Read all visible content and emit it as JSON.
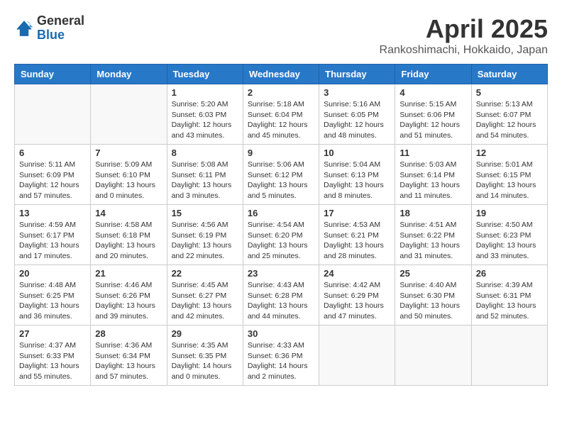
{
  "header": {
    "logo_general": "General",
    "logo_blue": "Blue",
    "title": "April 2025",
    "location": "Rankoshimachi, Hokkaido, Japan"
  },
  "days_of_week": [
    "Sunday",
    "Monday",
    "Tuesday",
    "Wednesday",
    "Thursday",
    "Friday",
    "Saturday"
  ],
  "weeks": [
    [
      {
        "day": "",
        "info": ""
      },
      {
        "day": "",
        "info": ""
      },
      {
        "day": "1",
        "info": "Sunrise: 5:20 AM\nSunset: 6:03 PM\nDaylight: 12 hours and 43 minutes."
      },
      {
        "day": "2",
        "info": "Sunrise: 5:18 AM\nSunset: 6:04 PM\nDaylight: 12 hours and 45 minutes."
      },
      {
        "day": "3",
        "info": "Sunrise: 5:16 AM\nSunset: 6:05 PM\nDaylight: 12 hours and 48 minutes."
      },
      {
        "day": "4",
        "info": "Sunrise: 5:15 AM\nSunset: 6:06 PM\nDaylight: 12 hours and 51 minutes."
      },
      {
        "day": "5",
        "info": "Sunrise: 5:13 AM\nSunset: 6:07 PM\nDaylight: 12 hours and 54 minutes."
      }
    ],
    [
      {
        "day": "6",
        "info": "Sunrise: 5:11 AM\nSunset: 6:09 PM\nDaylight: 12 hours and 57 minutes."
      },
      {
        "day": "7",
        "info": "Sunrise: 5:09 AM\nSunset: 6:10 PM\nDaylight: 13 hours and 0 minutes."
      },
      {
        "day": "8",
        "info": "Sunrise: 5:08 AM\nSunset: 6:11 PM\nDaylight: 13 hours and 3 minutes."
      },
      {
        "day": "9",
        "info": "Sunrise: 5:06 AM\nSunset: 6:12 PM\nDaylight: 13 hours and 5 minutes."
      },
      {
        "day": "10",
        "info": "Sunrise: 5:04 AM\nSunset: 6:13 PM\nDaylight: 13 hours and 8 minutes."
      },
      {
        "day": "11",
        "info": "Sunrise: 5:03 AM\nSunset: 6:14 PM\nDaylight: 13 hours and 11 minutes."
      },
      {
        "day": "12",
        "info": "Sunrise: 5:01 AM\nSunset: 6:15 PM\nDaylight: 13 hours and 14 minutes."
      }
    ],
    [
      {
        "day": "13",
        "info": "Sunrise: 4:59 AM\nSunset: 6:17 PM\nDaylight: 13 hours and 17 minutes."
      },
      {
        "day": "14",
        "info": "Sunrise: 4:58 AM\nSunset: 6:18 PM\nDaylight: 13 hours and 20 minutes."
      },
      {
        "day": "15",
        "info": "Sunrise: 4:56 AM\nSunset: 6:19 PM\nDaylight: 13 hours and 22 minutes."
      },
      {
        "day": "16",
        "info": "Sunrise: 4:54 AM\nSunset: 6:20 PM\nDaylight: 13 hours and 25 minutes."
      },
      {
        "day": "17",
        "info": "Sunrise: 4:53 AM\nSunset: 6:21 PM\nDaylight: 13 hours and 28 minutes."
      },
      {
        "day": "18",
        "info": "Sunrise: 4:51 AM\nSunset: 6:22 PM\nDaylight: 13 hours and 31 minutes."
      },
      {
        "day": "19",
        "info": "Sunrise: 4:50 AM\nSunset: 6:23 PM\nDaylight: 13 hours and 33 minutes."
      }
    ],
    [
      {
        "day": "20",
        "info": "Sunrise: 4:48 AM\nSunset: 6:25 PM\nDaylight: 13 hours and 36 minutes."
      },
      {
        "day": "21",
        "info": "Sunrise: 4:46 AM\nSunset: 6:26 PM\nDaylight: 13 hours and 39 minutes."
      },
      {
        "day": "22",
        "info": "Sunrise: 4:45 AM\nSunset: 6:27 PM\nDaylight: 13 hours and 42 minutes."
      },
      {
        "day": "23",
        "info": "Sunrise: 4:43 AM\nSunset: 6:28 PM\nDaylight: 13 hours and 44 minutes."
      },
      {
        "day": "24",
        "info": "Sunrise: 4:42 AM\nSunset: 6:29 PM\nDaylight: 13 hours and 47 minutes."
      },
      {
        "day": "25",
        "info": "Sunrise: 4:40 AM\nSunset: 6:30 PM\nDaylight: 13 hours and 50 minutes."
      },
      {
        "day": "26",
        "info": "Sunrise: 4:39 AM\nSunset: 6:31 PM\nDaylight: 13 hours and 52 minutes."
      }
    ],
    [
      {
        "day": "27",
        "info": "Sunrise: 4:37 AM\nSunset: 6:33 PM\nDaylight: 13 hours and 55 minutes."
      },
      {
        "day": "28",
        "info": "Sunrise: 4:36 AM\nSunset: 6:34 PM\nDaylight: 13 hours and 57 minutes."
      },
      {
        "day": "29",
        "info": "Sunrise: 4:35 AM\nSunset: 6:35 PM\nDaylight: 14 hours and 0 minutes."
      },
      {
        "day": "30",
        "info": "Sunrise: 4:33 AM\nSunset: 6:36 PM\nDaylight: 14 hours and 2 minutes."
      },
      {
        "day": "",
        "info": ""
      },
      {
        "day": "",
        "info": ""
      },
      {
        "day": "",
        "info": ""
      }
    ]
  ]
}
